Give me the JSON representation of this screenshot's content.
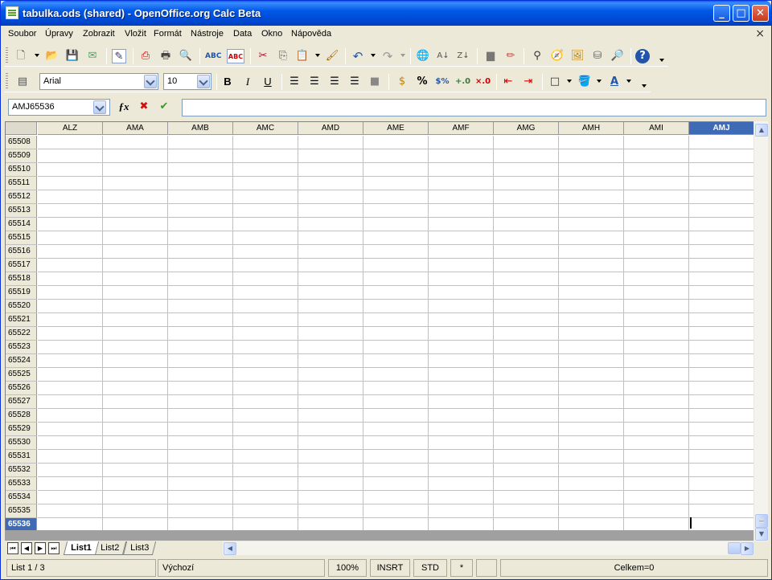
{
  "window": {
    "title": "tabulka.ods (shared) - OpenOffice.org Calc Beta",
    "minimize": "_",
    "maximize": "□",
    "close": "✕"
  },
  "menu": [
    "Soubor",
    "Úpravy",
    "Zobrazit",
    "Vložit",
    "Formát",
    "Nástroje",
    "Data",
    "Okno",
    "Nápověda"
  ],
  "menu_close": "×",
  "formatting": {
    "font_name": "Arial",
    "font_size": "10",
    "bold": "B",
    "italic": "I",
    "underline": "U",
    "percent": "%"
  },
  "formula_bar": {
    "cell_ref": "AMJ65536",
    "formula": ""
  },
  "grid": {
    "columns": [
      "ALZ",
      "AMA",
      "AMB",
      "AMC",
      "AMD",
      "AME",
      "AMF",
      "AMG",
      "AMH",
      "AMI",
      "AMJ"
    ],
    "selected_column": "AMJ",
    "rows": [
      "65508",
      "65509",
      "65510",
      "65511",
      "65512",
      "65513",
      "65514",
      "65515",
      "65516",
      "65517",
      "65518",
      "65519",
      "65520",
      "65521",
      "65522",
      "65523",
      "65524",
      "65525",
      "65526",
      "65527",
      "65528",
      "65529",
      "65530",
      "65531",
      "65532",
      "65533",
      "65534",
      "65535",
      "65536"
    ],
    "selected_row": "65536"
  },
  "sheets": [
    "List1",
    "List2",
    "List3"
  ],
  "active_sheet": "List1",
  "status": {
    "sheet": "List 1 / 3",
    "style": "Výchozí",
    "zoom": "100%",
    "insert_mode": "INSRT",
    "selection_mode": "STD",
    "modified": "*",
    "sum": "Celkem=0"
  },
  "colors": {
    "accent": "#3F6BB6",
    "titlebar": "#0058E6"
  }
}
